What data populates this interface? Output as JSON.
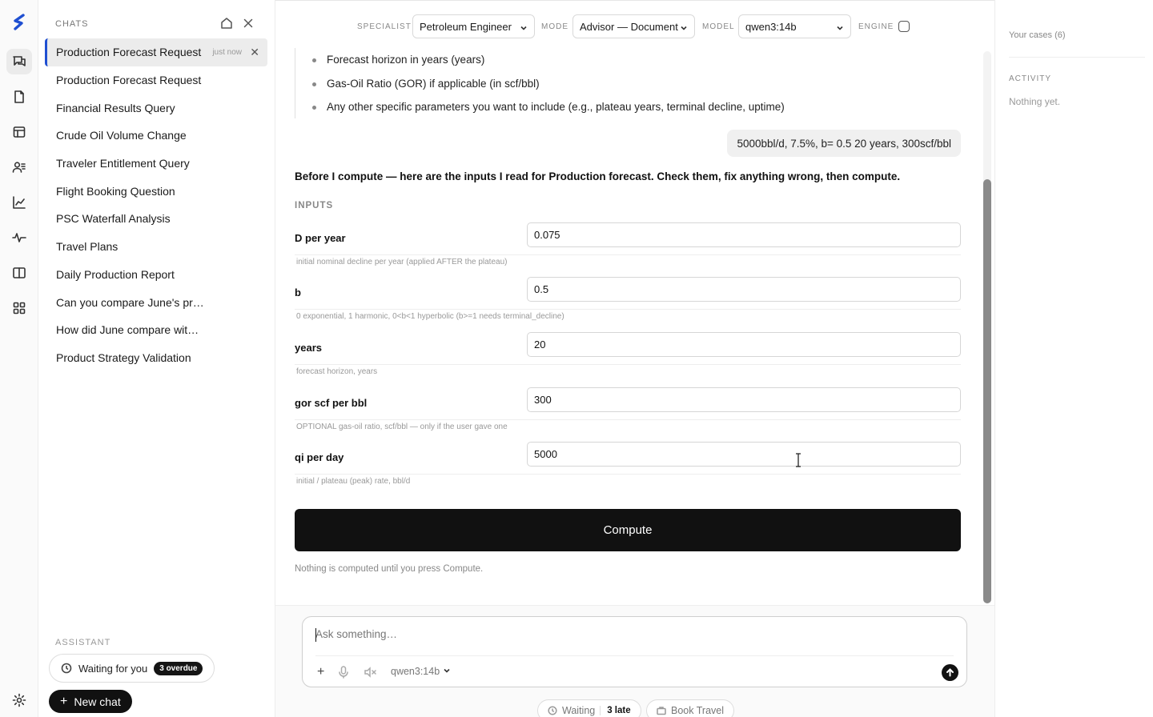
{
  "sidebar": {
    "header": "CHATS",
    "chats": [
      {
        "title": "Production Forecast Request",
        "time": "just now",
        "active": true
      },
      {
        "title": "Production Forecast Request"
      },
      {
        "title": "Financial Results Query"
      },
      {
        "title": "Crude Oil Volume Change"
      },
      {
        "title": "Traveler Entitlement Query"
      },
      {
        "title": "Flight Booking Question"
      },
      {
        "title": "PSC Waterfall Analysis"
      },
      {
        "title": "Travel Plans"
      },
      {
        "title": "Daily Production Report"
      },
      {
        "title": "Can you compare June's pr…"
      },
      {
        "title": "How did June compare wit…"
      },
      {
        "title": "Product Strategy Validation"
      }
    ],
    "assistant_label": "ASSISTANT",
    "waiting_label": "Waiting for you",
    "overdue_badge": "3 overdue",
    "new_chat_label": "New chat"
  },
  "topbar": {
    "specialist_label": "SPECIALIST",
    "specialist_value": "Petroleum Engineer",
    "mode_label": "MODE",
    "mode_value": "Advisor — Document",
    "model_label": "MODEL",
    "model_value": "qwen3:14b",
    "engine_label": "ENGINE"
  },
  "conversation": {
    "bullets": [
      "Forecast horizon in years (years)",
      "Gas-Oil Ratio (GOR) if applicable (in scf/bbl)",
      "Any other specific parameters you want to include (e.g., plateau years, terminal decline, uptime)"
    ],
    "user_message": "5000bbl/d, 7.5%, b= 0.5 20 years, 300scf/bbl",
    "intro": "Before I compute — here are the inputs I read for Production forecast. Check them, fix anything wrong, then compute.",
    "inputs_label": "INPUTS",
    "fields": [
      {
        "label": "D per year",
        "value": "0.075",
        "hint": "initial nominal decline per year (applied AFTER the plateau)"
      },
      {
        "label": "b",
        "value": "0.5",
        "hint": "0 exponential, 1 harmonic, 0<b<1 hyperbolic (b>=1 needs terminal_decline)"
      },
      {
        "label": "years",
        "value": "20",
        "hint": "forecast horizon, years"
      },
      {
        "label": "gor scf per bbl",
        "value": "300",
        "hint": "OPTIONAL gas-oil ratio, scf/bbl — only if the user gave one"
      },
      {
        "label": "qi per day",
        "value": "5000",
        "hint": "initial / plateau (peak) rate, bbl/d"
      }
    ],
    "compute_label": "Compute",
    "footnote": "Nothing is computed until you press Compute."
  },
  "composer": {
    "placeholder": "Ask something…",
    "plus_label": "+",
    "model": "qwen3:14b",
    "chips": {
      "waiting": "Waiting",
      "late": "3 late",
      "book_travel": "Book Travel"
    }
  },
  "right_panel": {
    "cases": "Your cases (6)",
    "activity_label": "ACTIVITY",
    "activity_empty": "Nothing yet."
  },
  "colors": {
    "accent": "#1f4fd1",
    "button_dark": "#111111"
  }
}
